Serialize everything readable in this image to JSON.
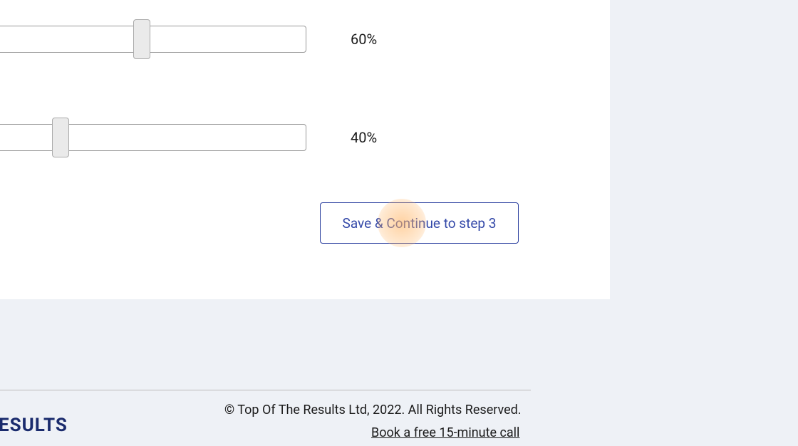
{
  "sliders": [
    {
      "value": "60%"
    },
    {
      "value": "40%"
    }
  ],
  "continueButton": {
    "label": "Save & Continue to step 3"
  },
  "footer": {
    "copyright": "© Top Of The Results Ltd, 2022. All Rights Reserved.",
    "link": "Book a free 15-minute call",
    "logoFragment": "ESULTS"
  }
}
